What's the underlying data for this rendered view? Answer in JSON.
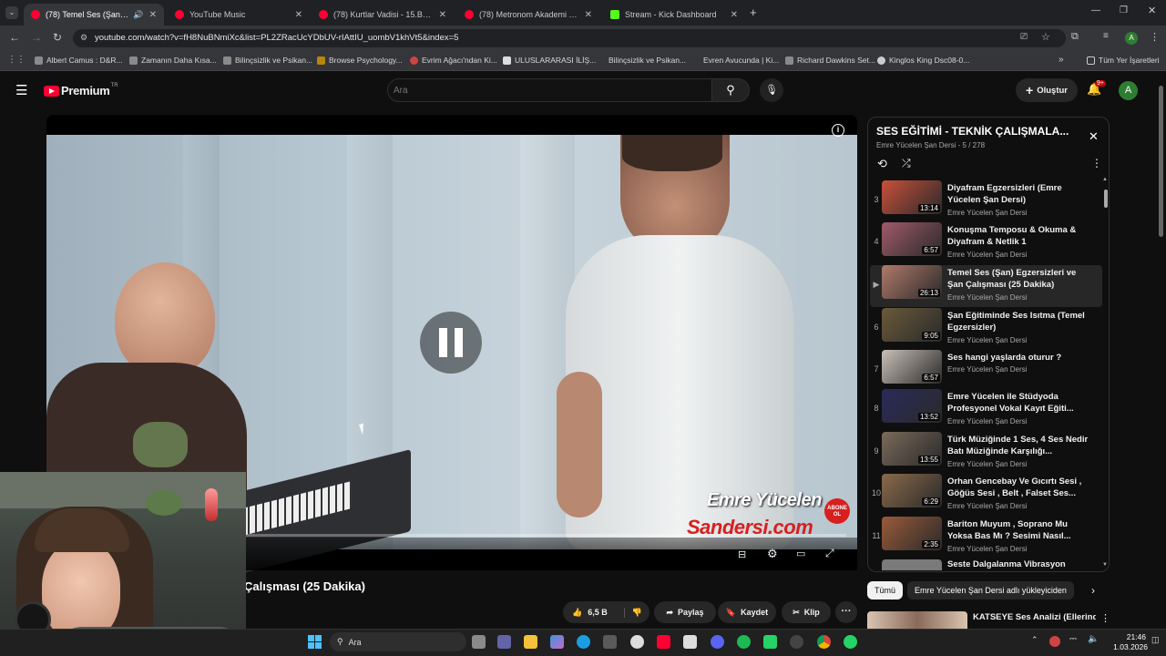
{
  "tabs": [
    {
      "title": "(78) Temel Ses (Şan) Egzersi",
      "active": true,
      "color": "#ff0033"
    },
    {
      "title": "YouTube Music",
      "active": false,
      "color": "#ff0033"
    },
    {
      "title": "(78) Kurtlar Vadisi - 15.Bölüm |",
      "active": false,
      "color": "#ff0033"
    },
    {
      "title": "(78) Metronom Akademi | 4. Bö",
      "active": false,
      "color": "#ff0033"
    },
    {
      "title": "Stream - Kick Dashboard",
      "active": false,
      "color": "#53fc18"
    }
  ],
  "browser": {
    "url": "youtube.com/watch?v=fH8NuBNmiXc&list=PL2ZRacUcYDbUV-rIAttIU_uombV1khVt5&index=5",
    "profile_initial": "A"
  },
  "bookmarks": [
    "Albert Camus : D&R...",
    "Zamanın Daha Kısa...",
    "Bilinçsizlik ve Psikan...",
    "Browse Psychology...",
    "Evrim Ağacı'ndan Ki...",
    "ULUSLARARASI İLİŞ...",
    "Bilinçsizlik ve Psikan...",
    "Evren Avucunda | Ki...",
    "Richard Dawkins Set...",
    "Kinglos King Dsc08-0..."
  ],
  "bookmarks_all": "Tüm Yer İşaretleri",
  "yt": {
    "logo": "Premium",
    "logo_sup": "TR",
    "search_placeholder": "Ara",
    "create_label": "Oluştur",
    "notif_badge": "9+",
    "avatar": "A"
  },
  "video": {
    "watermark_name": "Emre Yücelen",
    "watermark_site": "Sandersi.com",
    "watermark_badge": "ABONE OL",
    "progress": 0.1,
    "title_visible": "Çalışması (25 Dakika)",
    "likes": "6,5 B",
    "share": "Paylaş",
    "save": "Kaydet",
    "clip": "Klip"
  },
  "playlist": {
    "title": "SES EĞİTİMİ - TEKNİK ÇALIŞMALA...",
    "subtitle": "Emre Yücelen Şan Dersi - 5 / 278",
    "items": [
      {
        "num": "3",
        "title": "Diyafram Egzersizleri (Emre Yücelen Şan Dersi)",
        "channel": "Emre Yücelen Şan Dersi",
        "duration": "13:14",
        "thumb": "#c8503a"
      },
      {
        "num": "4",
        "title": "Konuşma Temposu & Okuma & Diyafram & Netlik 1",
        "channel": "Emre Yücelen Şan Dersi",
        "duration": "6:57",
        "thumb": "#a05a6a"
      },
      {
        "num": "▶",
        "title": "Temel Ses (Şan) Egzersizleri ve Şan Çalışması (25 Dakika)",
        "channel": "Emre Yücelen Şan Dersi",
        "duration": "26:13",
        "thumb": "#b07a6a",
        "current": true
      },
      {
        "num": "6",
        "title": "Şan Eğitiminde Ses Isıtma (Temel Egzersizler)",
        "channel": "Emre Yücelen Şan Dersi",
        "duration": "9:05",
        "thumb": "#6a5a3a"
      },
      {
        "num": "7",
        "title": "Ses hangi yaşlarda oturur ?",
        "channel": "Emre Yücelen Şan Dersi",
        "duration": "6:57",
        "thumb": "#c8c0b8"
      },
      {
        "num": "8",
        "title": "Emre Yücelen ile Stüdyoda Profesyonel Vokal Kayıt Eğiti...",
        "channel": "Emre Yücelen Şan Dersi",
        "duration": "13:52",
        "thumb": "#2a2a5a"
      },
      {
        "num": "9",
        "title": "Türk Müziğinde 1 Ses, 4 Ses Nedir Batı Müziğinde Karşılığı...",
        "channel": "Emre Yücelen Şan Dersi",
        "duration": "13:55",
        "thumb": "#7a6a5a"
      },
      {
        "num": "10",
        "title": "Orhan Gencebay Ve Gıcırtı Sesi , Göğüs Sesi , Belt , Falset Ses...",
        "channel": "Emre Yücelen Şan Dersi",
        "duration": "6:29",
        "thumb": "#8a6a4a"
      },
      {
        "num": "11",
        "title": "Bariton Muyum , Soprano Mu Yoksa Bas Mı ? Sesimi Nasıl...",
        "channel": "Emre Yücelen Şan Dersi",
        "duration": "2:35",
        "thumb": "#9a5a3a"
      }
    ],
    "partial_title": "Seste Dalgalanma Vibrasyon"
  },
  "chips": [
    "Tümü",
    "Emre Yücelen Şan Dersi adlı yükleyiciden"
  ],
  "related": {
    "title": "KATSEYE Ses Analizi (Ellerinde"
  },
  "taskbar": {
    "search": "Ara",
    "time": "21:46",
    "date": "1.03.2026"
  }
}
